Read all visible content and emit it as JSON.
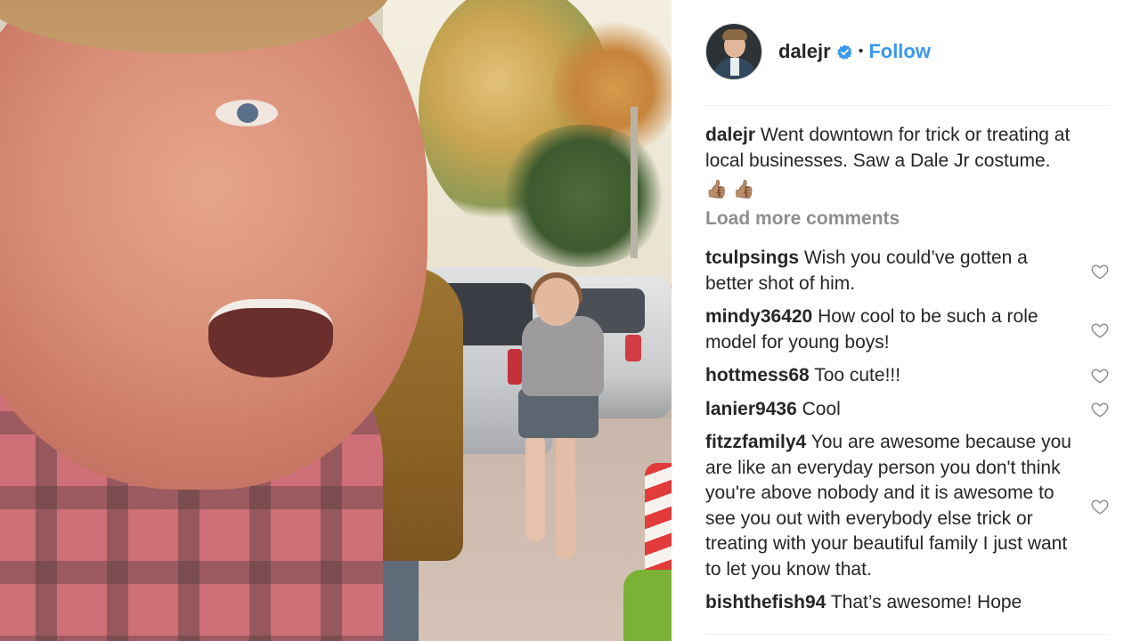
{
  "post": {
    "username": "dalejr",
    "verified": true,
    "dot": "•",
    "follow_label": "Follow",
    "caption": {
      "username": "dalejr",
      "text": "Went downtown for trick or treating at local businesses. Saw a Dale Jr costume.",
      "emojis": [
        "👍🏽",
        "👍🏽"
      ]
    },
    "load_more_label": "Load more comments"
  },
  "comments": [
    {
      "username": "tculpsings",
      "text": "Wish you could’ve gotten a better shot of him."
    },
    {
      "username": "mindy36420",
      "text": "How cool to be such a role model for young boys!"
    },
    {
      "username": "hottmess68",
      "text": "Too cute!!!"
    },
    {
      "username": "lanier9436",
      "text": "Cool"
    },
    {
      "username": "fitzzfamily4",
      "text": "You are awesome because you are like an everyday person you don't think you're above nobody and it is awesome to see you out with everybody else trick or treating with your beautiful family I just want to let you know that."
    },
    {
      "username": "bishthefish94",
      "text": "That’s awesome! Hope"
    }
  ],
  "icons": {
    "verified": "verified-badge-icon",
    "like": "heart-outline-icon"
  },
  "colors": {
    "link": "#3897f0",
    "verified": "#3897f0",
    "muted": "#8e8e8e",
    "text": "#262626"
  }
}
